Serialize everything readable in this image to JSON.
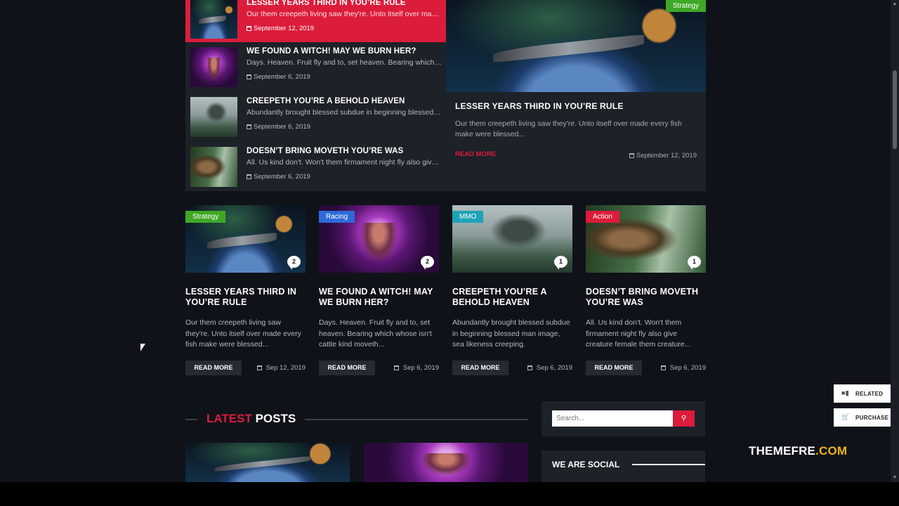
{
  "top_list": [
    {
      "title": "LESSER YEARS THIRD IN YOU’RE RULE",
      "excerpt": "Our them creepeth living saw they're. Unto itself over made every fish make were blessed",
      "date": "September 12, 2019"
    },
    {
      "title": "WE FOUND A WITCH! MAY WE BURN HER?",
      "excerpt": "Days. Heaven. Fruit fly and to, set heaven. Bearing which whose isn't",
      "date": "September 6, 2019"
    },
    {
      "title": "CREEPETH YOU’RE A BEHOLD HEAVEN",
      "excerpt": "Abundantly brought blessed subdue in beginning blessed man image",
      "date": "September 6, 2019"
    },
    {
      "title": "DOESN’T BRING MOVETH YOU’RE WAS",
      "excerpt": "All. Us kind don't. Won't them firmament night fly also give creature",
      "date": "September 6, 2019"
    }
  ],
  "featured": {
    "category": "Strategy",
    "title": "LESSER YEARS THIRD IN YOU’RE RULE",
    "excerpt": "Our them creepeth living saw they're. Unto itself over made every fish make were blessed...",
    "read_more": "READ MORE",
    "date": "September 12, 2019"
  },
  "cards": [
    {
      "category": "Strategy",
      "comments": "2",
      "title": "LESSER YEARS THIRD IN YOU’RE RULE",
      "excerpt": "Our them creepeth living saw they're. Unto itself over made every fish make were blessed...",
      "button": "READ MORE",
      "date": "Sep 12, 2019"
    },
    {
      "category": "Racing",
      "comments": "2",
      "title": "WE FOUND A WITCH! MAY WE BURN HER?",
      "excerpt": "Days. Heaven. Fruit fly and to, set heaven. Bearing which whose isn't cattle kind moveth...",
      "button": "READ MORE",
      "date": "Sep 6, 2019"
    },
    {
      "category": "MMO",
      "comments": "1",
      "title": "CREEPETH YOU’RE A BEHOLD HEAVEN",
      "excerpt": "Abundantly brought blessed subdue in beginning blessed man image, sea likeness creeping.",
      "button": "READ MORE",
      "date": "Sep 6, 2019"
    },
    {
      "category": "Action",
      "comments": "1",
      "title": "DOESN’T BRING MOVETH YOU’RE WAS",
      "excerpt": "All. Us kind don't. Won't them firmament night fly also give creature female them creature...",
      "button": "READ MORE",
      "date": "Sep 6, 2019"
    }
  ],
  "latest": {
    "highlight": "LATEST",
    "rest": "POSTS"
  },
  "search": {
    "placeholder": "Search..."
  },
  "social": {
    "title": "WE ARE SOCIAL"
  },
  "floating": {
    "related": "RELATED",
    "purchase": "PURCHASE"
  },
  "watermark": {
    "main": "THEMEFRE",
    "suffix": ".COM"
  },
  "colors": {
    "accent": "#dc1c3b",
    "strategy": "#3fa825",
    "racing": "#2d6ad8",
    "mmo": "#1ea3b6",
    "action": "#dc1c3b",
    "bg": "#0f1319",
    "panel": "#1d2128"
  }
}
